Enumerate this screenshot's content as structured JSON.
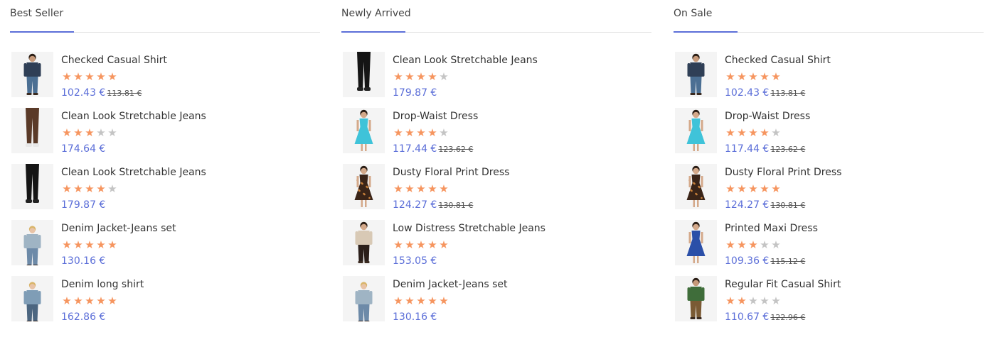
{
  "columns": [
    {
      "title": "Best Seller",
      "products": [
        {
          "name": "Checked Casual Shirt",
          "rating": 5,
          "price": "102.43 €",
          "old_price": "113.81 €",
          "image": "checked-shirt-man"
        },
        {
          "name": "Clean Look Stretchable Jeans",
          "rating": 3,
          "price": "174.64 €",
          "old_price": "",
          "image": "brown-jeans"
        },
        {
          "name": "Clean Look Stretchable Jeans",
          "rating": 4,
          "price": "179.87 €",
          "old_price": "",
          "image": "black-jeans"
        },
        {
          "name": "Denim Jacket-Jeans set",
          "rating": 5,
          "price": "130.16 €",
          "old_price": "",
          "image": "kid-denim-set"
        },
        {
          "name": "Denim long shirt",
          "rating": 5,
          "price": "162.86 €",
          "old_price": "",
          "image": "kid-denim-shirt"
        }
      ]
    },
    {
      "title": "Newly Arrived",
      "products": [
        {
          "name": "Clean Look Stretchable Jeans",
          "rating": 4,
          "price": "179.87 €",
          "old_price": "",
          "image": "black-jeans"
        },
        {
          "name": "Drop-Waist Dress",
          "rating": 4,
          "price": "117.44 €",
          "old_price": "123.62 €",
          "image": "turquoise-dress"
        },
        {
          "name": "Dusty Floral Print Dress",
          "rating": 5,
          "price": "124.27 €",
          "old_price": "130.81 €",
          "image": "floral-dress"
        },
        {
          "name": "Low Distress Stretchable Jeans",
          "rating": 5,
          "price": "153.05 €",
          "old_price": "",
          "image": "woman-dark-jeans"
        },
        {
          "name": "Denim Jacket-Jeans set",
          "rating": 5,
          "price": "130.16 €",
          "old_price": "",
          "image": "kid-denim-set"
        }
      ]
    },
    {
      "title": "On Sale",
      "products": [
        {
          "name": "Checked Casual Shirt",
          "rating": 5,
          "price": "102.43 €",
          "old_price": "113.81 €",
          "image": "checked-shirt-man"
        },
        {
          "name": "Drop-Waist Dress",
          "rating": 4,
          "price": "117.44 €",
          "old_price": "123.62 €",
          "image": "turquoise-dress"
        },
        {
          "name": "Dusty Floral Print Dress",
          "rating": 5,
          "price": "124.27 €",
          "old_price": "130.81 €",
          "image": "floral-dress"
        },
        {
          "name": "Printed Maxi Dress",
          "rating": 3,
          "price": "109.36 €",
          "old_price": "115.12 €",
          "image": "blue-maxi-dress"
        },
        {
          "name": "Regular Fit Casual Shirt",
          "rating": 2,
          "price": "110.67 €",
          "old_price": "122.96 €",
          "image": "green-shirt-man"
        }
      ]
    }
  ],
  "colors": {
    "accent": "#5b6ed8",
    "star_on": "#f6955f",
    "star_off": "#c4c4c4",
    "divider": "#e2e2e2"
  }
}
